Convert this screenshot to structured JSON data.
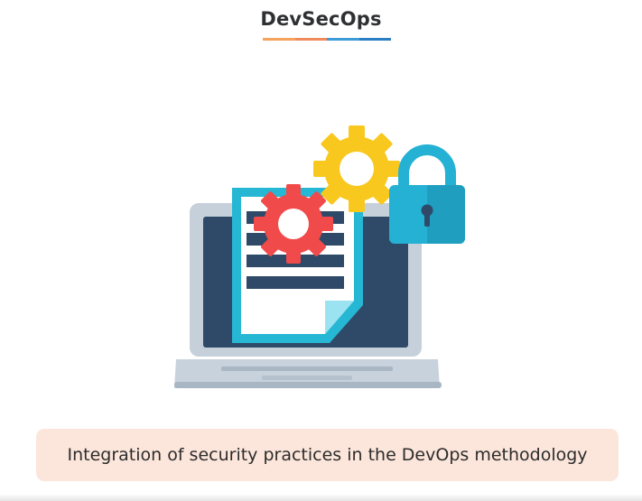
{
  "slide": {
    "title": "DevSecOps",
    "caption": "Integration of security practices in the DevOps methodology"
  },
  "colors": {
    "underline": [
      "#f5a25d",
      "#f08a5d",
      "#3d9bd8",
      "#2a7fc4"
    ],
    "caption_bg": "#fce6db",
    "screen": "#2e4a68",
    "document_border": "#26b7d4",
    "gear_red": "#f14a4a",
    "gear_yellow": "#f9c81e",
    "lock_body": "#24b1d3",
    "laptop_body": "#c5d0da"
  },
  "icons": [
    "laptop-icon",
    "document-icon",
    "red-gear-icon",
    "yellow-gear-icon",
    "padlock-icon"
  ]
}
